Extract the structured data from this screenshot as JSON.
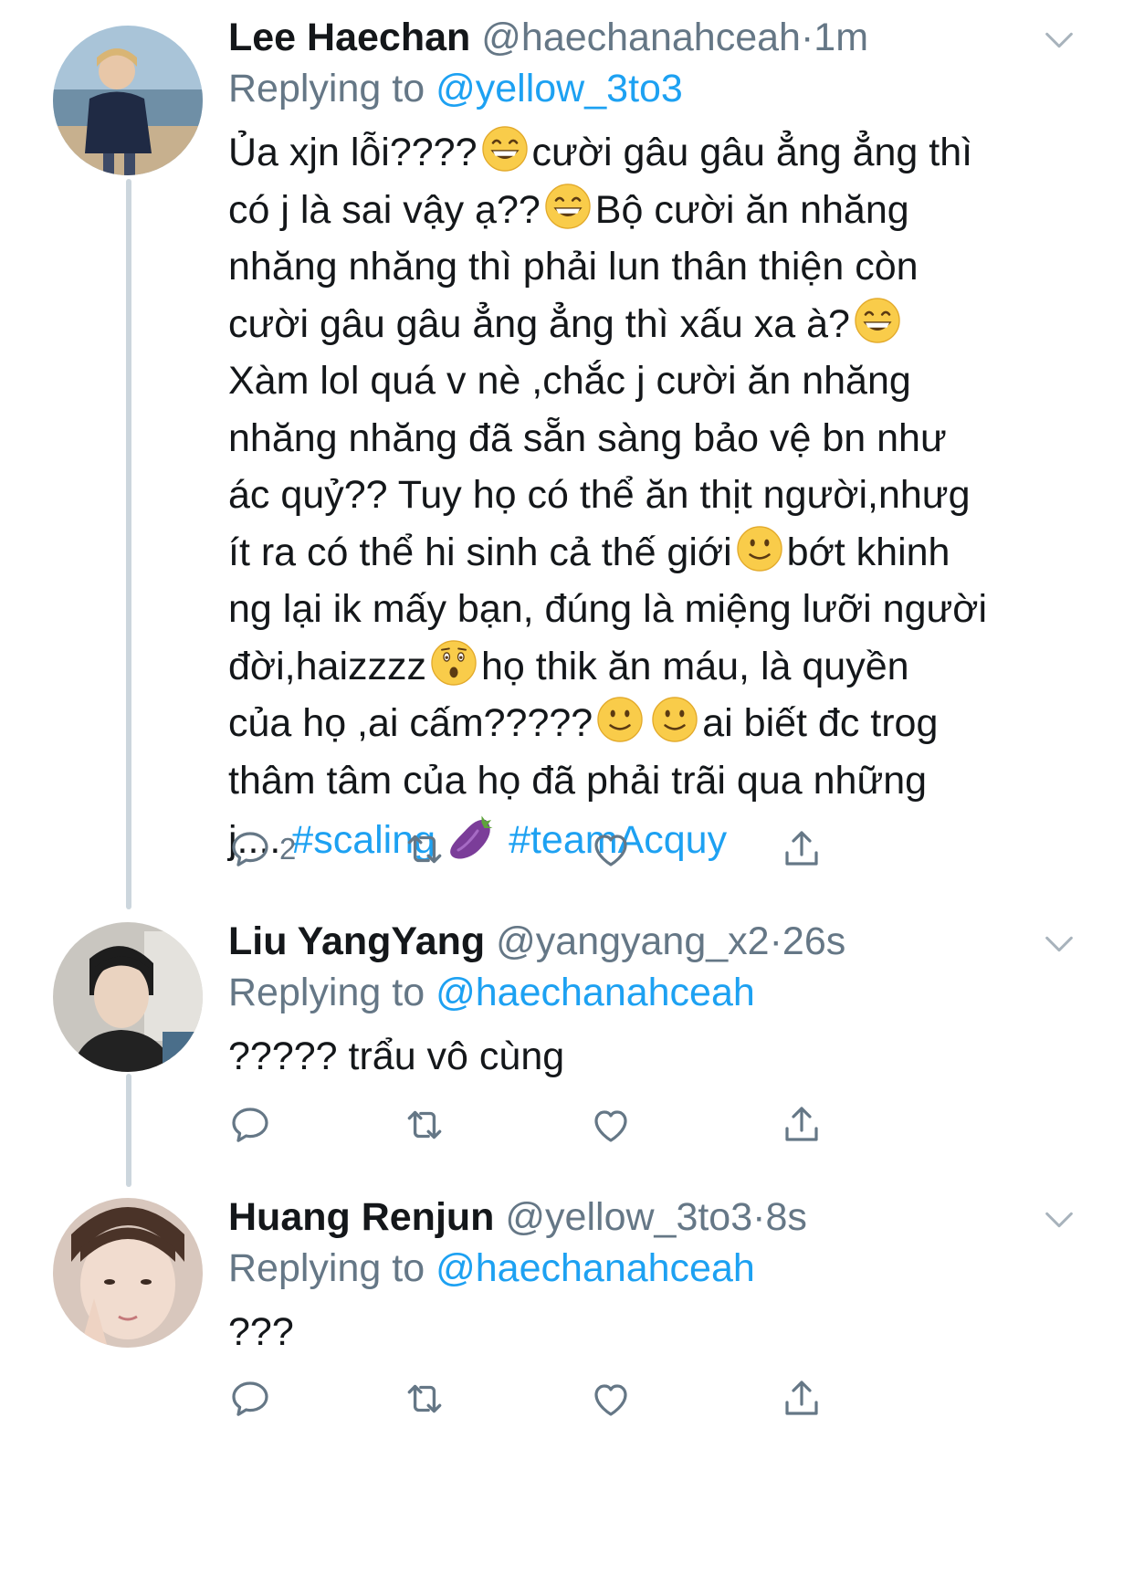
{
  "colors": {
    "text": "#14171a",
    "secondary": "#657786",
    "link": "#1da1f2",
    "thread": "#ccd6dd"
  },
  "tweets": [
    {
      "name": "Lee Haechan",
      "handle": "@haechanahceah",
      "dot": "·",
      "time": "1m",
      "reply_prefix": "Replying to",
      "reply_to": "@yellow_3to3",
      "lines": [
        [
          "Ủa xjn lỗi????",
          "grinning-face-emoji",
          "cười gâu gâu ẳng ẳng thì"
        ],
        [
          "có j là sai vậy ạ??",
          "grinning-face-emoji",
          "Bộ cười ăn nhăng"
        ],
        [
          "nhăng nhăng thì phải lun thân thiện còn"
        ],
        [
          "cười gâu gâu ẳng ẳng thì xấu xa à?",
          "grinning-face-emoji"
        ],
        [
          "Xàm lol quá v nè ,chắc j cười ăn nhăng"
        ],
        [
          "nhăng nhăng đã sẵn sàng bảo vệ bn như"
        ],
        [
          "ác quỷ?? Tuy họ có thể ăn thịt người,nhưg"
        ],
        [
          "ít ra có thể hi sinh cả thế giới",
          "slightly-smiling-face-emoji",
          "bớt khinh"
        ],
        [
          "ng lại ik mấy bạn, đúng là miệng lưỡi người"
        ],
        [
          "đời,haizzzz",
          "hushed-face-emoji",
          "họ thik ăn máu, là quyền"
        ],
        [
          "của họ ,ai cấm?????",
          "slightly-smiling-face-emoji",
          "slightly-smiling-face-emoji",
          "ai biết đc trog"
        ],
        [
          "thâm tâm của họ đã phải trãi qua những"
        ],
        [
          "j....",
          "#scaling",
          "eggplant-emoji",
          "#teamAcquy"
        ]
      ],
      "reply_count": "2"
    },
    {
      "name": "Liu YangYang",
      "handle": "@yangyang_x2",
      "dot": "·",
      "time": "26s",
      "reply_prefix": "Replying to",
      "reply_to": "@haechanahceah",
      "text": "????? trẩu vô cùng",
      "reply_count": ""
    },
    {
      "name": "Huang Renjun",
      "handle": "@yellow_3to3",
      "dot": "·",
      "time": "8s",
      "reply_prefix": "Replying to",
      "reply_to": "@haechanahceah",
      "text": "???",
      "reply_count": ""
    }
  ],
  "icons": [
    "reply-icon",
    "retweet-icon",
    "like-icon",
    "share-icon",
    "chevron-down-icon"
  ]
}
